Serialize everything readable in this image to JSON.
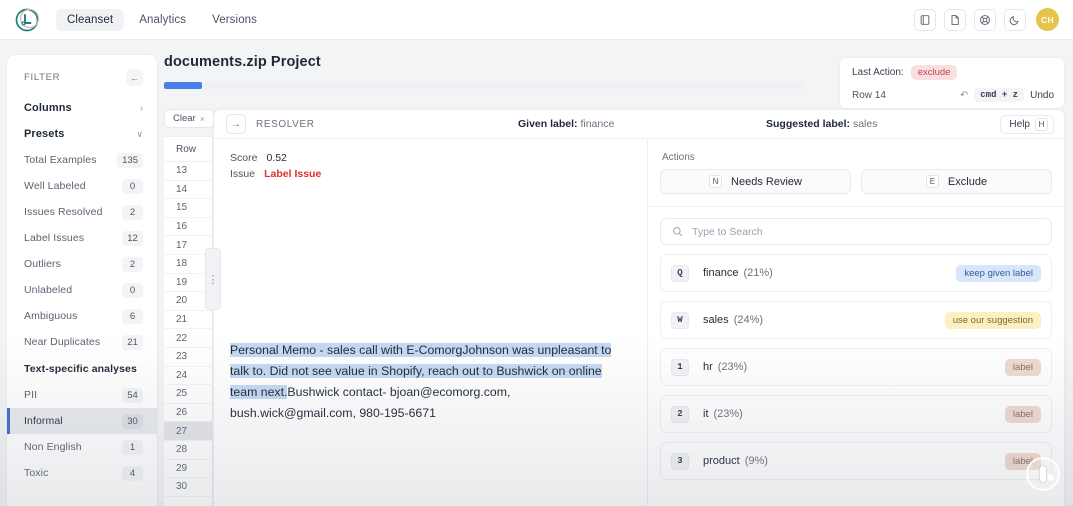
{
  "topnav": {
    "logo_text": "L",
    "links": [
      {
        "label": "Cleanset",
        "active": true
      },
      {
        "label": "Analytics",
        "active": false
      },
      {
        "label": "Versions",
        "active": false
      }
    ],
    "icons": [
      "book-icon",
      "document-icon",
      "lifebuoy-icon",
      "moon-icon"
    ],
    "avatar_initials": "CH",
    "avatar_color": "#e4c44c"
  },
  "sidebar": {
    "filter_title": "FILTER",
    "collapse_icon": "←",
    "groups": [
      {
        "label": "Columns",
        "chevron": "›"
      },
      {
        "label": "Presets",
        "chevron": "∨"
      }
    ],
    "items": [
      {
        "label": "Total Examples",
        "count": "135",
        "selected": false
      },
      {
        "label": "Well Labeled",
        "count": "0",
        "selected": false
      },
      {
        "label": "Issues Resolved",
        "count": "2",
        "selected": false
      },
      {
        "label": "Label Issues",
        "count": "12",
        "selected": false
      },
      {
        "label": "Outliers",
        "count": "2",
        "selected": false
      },
      {
        "label": "Unlabeled",
        "count": "0",
        "selected": false
      },
      {
        "label": "Ambiguous",
        "count": "6",
        "selected": false
      },
      {
        "label": "Near Duplicates",
        "count": "21",
        "selected": false
      }
    ],
    "subhead": "Text-specific analyses",
    "text_items": [
      {
        "label": "PII",
        "count": "54",
        "selected": false
      },
      {
        "label": "Informal",
        "count": "30",
        "selected": true
      },
      {
        "label": "Non English",
        "count": "1",
        "selected": false
      },
      {
        "label": "Toxic",
        "count": "4",
        "selected": false
      }
    ]
  },
  "main": {
    "project_title": "documents.zip Project",
    "progress_percent": 6,
    "last_action": {
      "label": "Last Action:",
      "action": "exclude",
      "row": "Row 14",
      "undo_icon": "↶",
      "shortcut": "cmd + z",
      "undo_label": "Undo"
    },
    "clear_button": {
      "label": "Clear",
      "close_icon": "×"
    },
    "table": {
      "column_header": "Row",
      "rows": [
        "13",
        "14",
        "15",
        "16",
        "17",
        "18",
        "19",
        "20",
        "21",
        "22",
        "23",
        "24",
        "25",
        "26",
        "27",
        "28",
        "29",
        "30"
      ],
      "selected_rows": [
        "27"
      ],
      "drag_handle_icon": "⋮"
    }
  },
  "resolver": {
    "arrow_icon": "→",
    "title": "RESOLVER",
    "given_label_key": "Given label:",
    "given_label_value": "finance",
    "suggested_label_key": "Suggested label:",
    "suggested_label_value": "sales",
    "help_label": "Help",
    "help_key": "H",
    "score_key": "Score",
    "score_value": "0.52",
    "issue_key": "Issue",
    "issue_value": "Label Issue",
    "memo": {
      "highlighted": "Personal Memo - sales call with E-ComorgJohnson was unpleasant to talk to. Did not see value in Shopify, reach out to Bushwick on online team next.",
      "rest": "Bushwick contact- bjoan@ecomorg.com, bush.wick@gmail.com, 980-195-6671"
    }
  },
  "actions": {
    "title": "Actions",
    "buttons": [
      {
        "key": "N",
        "label": "Needs Review"
      },
      {
        "key": "E",
        "label": "Exclude"
      }
    ],
    "search_placeholder": "Type to Search",
    "search_value": "",
    "search_icon": "search-icon",
    "labels": [
      {
        "key": "Q",
        "name": "finance",
        "pct": "(21%)",
        "tag": "keep given label",
        "tag_style": "keep"
      },
      {
        "key": "W",
        "name": "sales",
        "pct": "(24%)",
        "tag": "use our suggestion",
        "tag_style": "sugg"
      },
      {
        "key": "1",
        "name": "hr",
        "pct": "(23%)",
        "tag": "label",
        "tag_style": "plain"
      },
      {
        "key": "2",
        "name": "it",
        "pct": "(23%)",
        "tag": "label",
        "tag_style": "plain"
      },
      {
        "key": "3",
        "name": "product",
        "pct": "(9%)",
        "tag": "label",
        "tag_style": "plain"
      }
    ]
  }
}
